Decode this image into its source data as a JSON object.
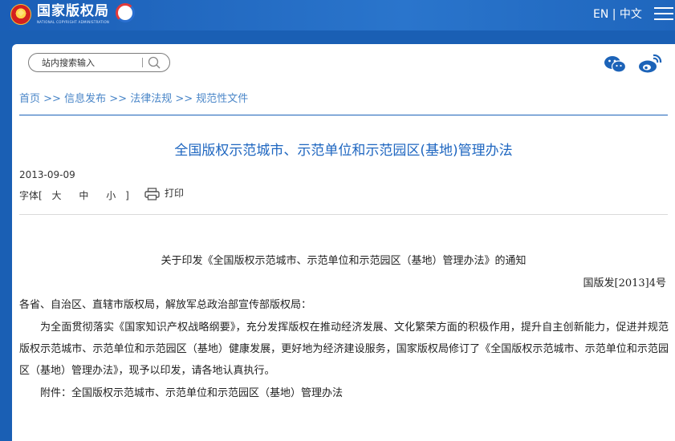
{
  "header": {
    "logo_cn": "国家版权局",
    "logo_en": "NATIONAL COPYRIGHT ADMINISTRATION",
    "lang_label": "EN | 中文"
  },
  "search": {
    "placeholder": "站内搜索输入"
  },
  "breadcrumb": {
    "items": [
      "首页",
      "信息发布",
      "法律法规",
      "规范性文件"
    ],
    "separator": ">>"
  },
  "article": {
    "title": "全国版权示范城市、示范单位和示范园区(基地)管理办法",
    "date": "2013-09-09",
    "font_label": "字体",
    "font_open": "[",
    "font_close": "]",
    "font_sizes": [
      "大",
      "中",
      "小"
    ],
    "print_label": "打印"
  },
  "document": {
    "notice_title": "关于印发《全国版权示范城市、示范单位和示范园区（基地）管理办法》的通知",
    "doc_number": "国版发[2013]4号",
    "addressee": "各省、自治区、直辖市版权局，解放军总政治部宣传部版权局：",
    "body": "为全面贯彻落实《国家知识产权战略纲要》，充分发挥版权在推动经济发展、文化繁荣方面的积极作用，提升自主创新能力，促进并规范版权示范城市、示范单位和示范园区（基地）健康发展，更好地为经济建设服务，国家版权局修订了《全国版权示范城市、示范单位和示范园区（基地）管理办法》，现予以印发，请各地认真执行。",
    "attachment": "附件：全国版权示范城市、示范单位和示范园区（基地）管理办法"
  },
  "colors": {
    "brand_blue": "#1a5fb4",
    "link_blue": "#4a86c8",
    "title_blue": "#1e66c0"
  }
}
